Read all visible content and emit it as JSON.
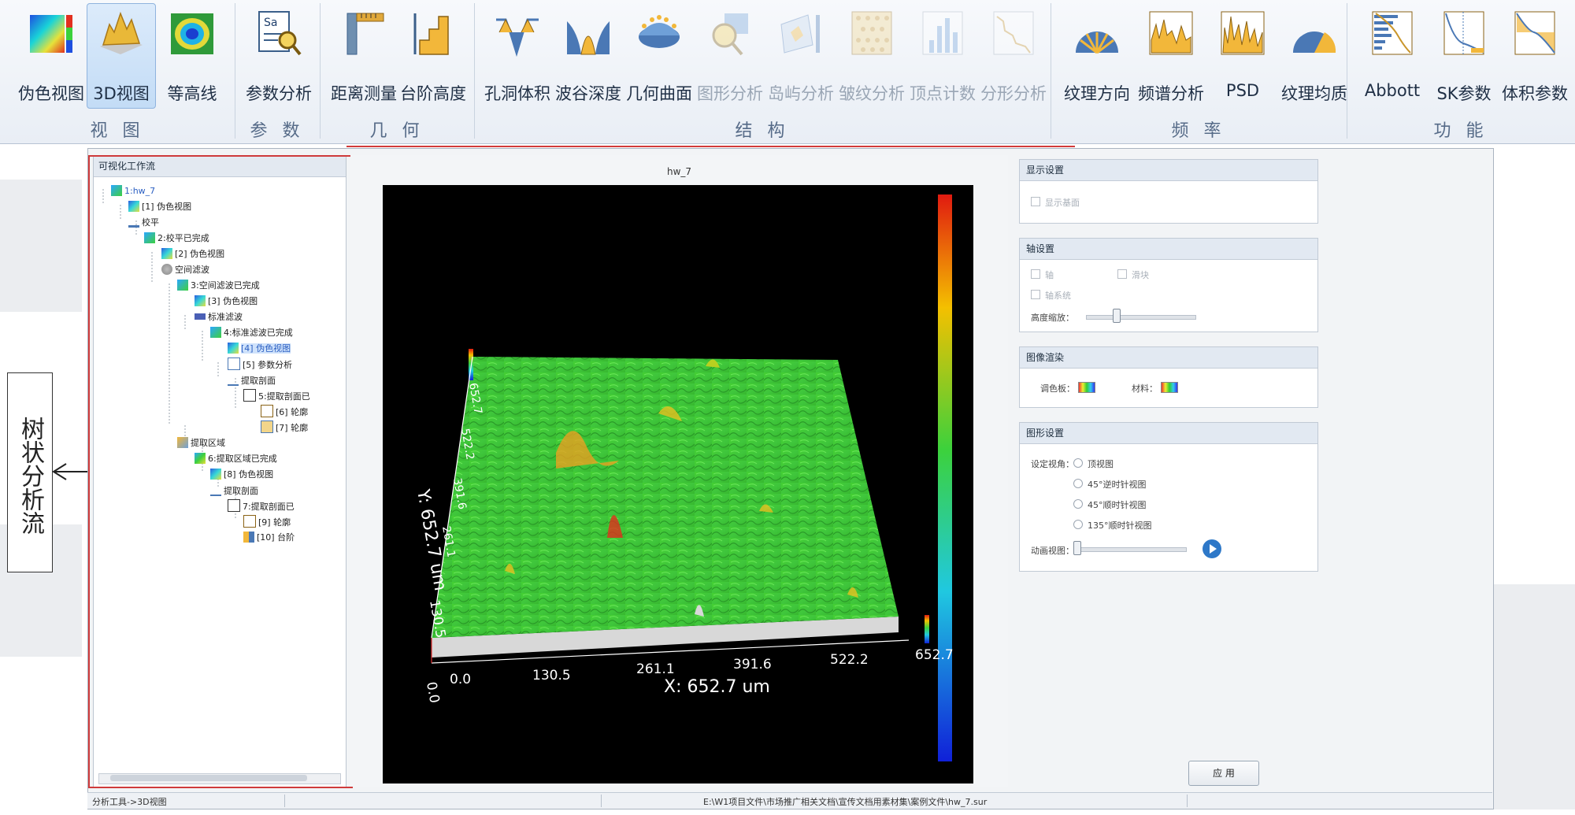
{
  "ribbon": {
    "groups": [
      {
        "label": "视 图"
      },
      {
        "label": "参 数"
      },
      {
        "label": "几 何"
      },
      {
        "label": "结 构"
      },
      {
        "label": "频 率"
      },
      {
        "label": "功 能"
      }
    ],
    "buttons": {
      "pseudo_color": "伪色视图",
      "view_3d": "3D视图",
      "contour": "等高线",
      "param_analysis": "参数分析",
      "distance": "距离测量",
      "step_height": "台阶高度",
      "hole_volume": "孔洞体积",
      "valley_depth": "波谷深度",
      "geo_surface": "几何曲面",
      "shape_analysis": "图形分析",
      "island_analysis": "岛屿分析",
      "wrinkle_analysis": "皱纹分析",
      "peak_count": "顶点计数",
      "fractal_analysis": "分形分析",
      "texture_direction": "纹理方向",
      "spectrum_analysis": "频谱分析",
      "psd": "PSD",
      "texture_uniformity": "纹理均质",
      "abbott": "Abbott",
      "sk_params": "SK参数",
      "volume_params": "体积参数"
    },
    "sa_icon_text": "Sa"
  },
  "side_label": "树状分析流",
  "tree": {
    "title": "可视化工作流",
    "nodes": [
      {
        "text": "1:hw_7"
      },
      {
        "text": "[1] 伪色视图"
      },
      {
        "text": "校平"
      },
      {
        "text": "2:校平已完成"
      },
      {
        "text": "[2] 伪色视图"
      },
      {
        "text": "空间滤波"
      },
      {
        "text": "3:空间滤波已完成"
      },
      {
        "text": "[3] 伪色视图"
      },
      {
        "text": "标准滤波"
      },
      {
        "text": "4:标准滤波已完成"
      },
      {
        "text": "[4] 伪色视图"
      },
      {
        "text": "[5] 参数分析"
      },
      {
        "text": "提取剖面"
      },
      {
        "text": "5:提取剖面已"
      },
      {
        "text": "[6] 轮廓"
      },
      {
        "text": "[7] 轮廓"
      },
      {
        "text": "提取区域"
      },
      {
        "text": "6:提取区域已完成"
      },
      {
        "text": "[8] 伪色视图"
      },
      {
        "text": "提取剖面"
      },
      {
        "text": "7:提取剖面已"
      },
      {
        "text": "[9] 轮廓"
      },
      {
        "text": "[10] 台阶"
      }
    ]
  },
  "viewer": {
    "title": "hw_7",
    "x_axis_label": "X: 652.7 um",
    "y_axis_label": "Y: 652.7 um",
    "x_ticks": [
      "0.0",
      "130.5",
      "261.1",
      "391.6",
      "522.2",
      "652.7"
    ],
    "y_ticks": [
      "0.0",
      "130.5",
      "261.1",
      "391.6",
      "522.2",
      "652.7"
    ]
  },
  "right": {
    "display": {
      "title": "显示设置",
      "show_base": "显示基面"
    },
    "axis": {
      "title": "轴设置",
      "axis": "轴",
      "colorbar": "滑块",
      "axis_system": "轴系统",
      "height_scale": "高度缩放："
    },
    "render": {
      "title": "图像渲染",
      "palette": "调色板：",
      "material": "材料："
    },
    "graphic": {
      "title": "图形设置",
      "view_angle": "设定视角：",
      "options": [
        "顶视图",
        "45°逆时针视图",
        "45°顺时针视图",
        "135°顺时针视图"
      ],
      "animation": "动画视图："
    },
    "apply": "应 用"
  },
  "status": {
    "left": "分析工具->3D视图",
    "path": "E:\\W1项目文件\\市场推广相关文档\\宣传文档用素材集\\案例文件\\hw_7.sur"
  },
  "colors": {
    "accent": "#2e78c8",
    "highlight_border": "#cf3b3b",
    "ribbon_bg": "#eef2f7",
    "surface": "#3fc63c"
  }
}
